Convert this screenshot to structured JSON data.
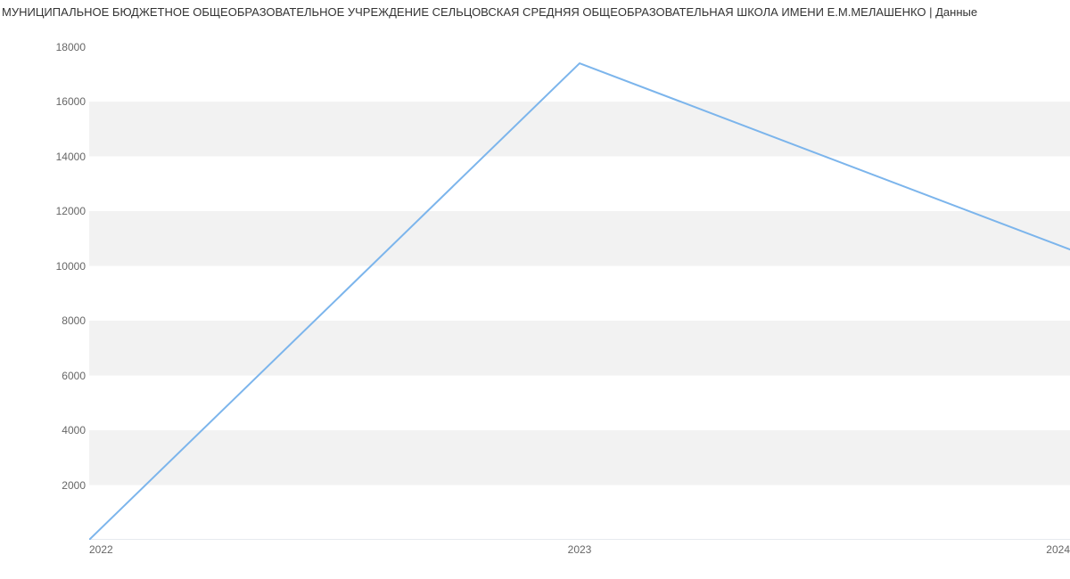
{
  "title": "МУНИЦИПАЛЬНОЕ БЮДЖЕТНОЕ  ОБЩЕОБРАЗОВАТЕЛЬНОЕ УЧРЕЖДЕНИЕ СЕЛЬЦОВСКАЯ СРЕДНЯЯ ОБЩЕОБРАЗОВАТЕЛЬНАЯ ШКОЛА ИМЕНИ Е.М.МЕЛАШЕНКО | Данные",
  "chart_data": {
    "type": "line",
    "x": [
      2022,
      2023,
      2024
    ],
    "series": [
      {
        "name": "Данные",
        "values": [
          0,
          17400,
          10600
        ],
        "color": "#7cb5ec"
      }
    ],
    "y_ticks": [
      2000,
      4000,
      6000,
      8000,
      10000,
      12000,
      14000,
      16000,
      18000
    ],
    "x_ticks": [
      2022,
      2023,
      2024
    ],
    "ylim": [
      0,
      18800
    ],
    "xlim": [
      2022,
      2024
    ],
    "xlabel": "",
    "ylabel": ""
  }
}
